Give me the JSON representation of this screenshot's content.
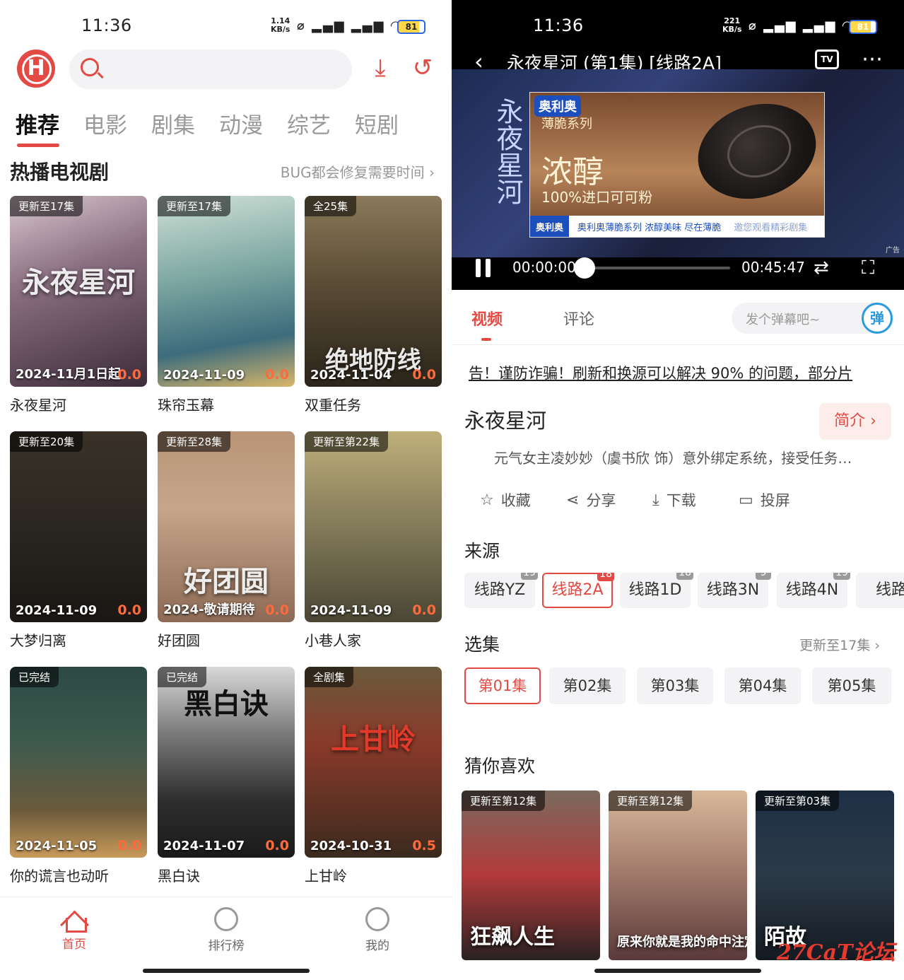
{
  "left": {
    "status": {
      "time": "11:36",
      "speed_top": "1.14",
      "speed_unit": "KB/s",
      "battery": "81"
    },
    "logo": "H",
    "tabs": [
      "推荐",
      "电影",
      "剧集",
      "动漫",
      "综艺",
      "短剧"
    ],
    "section_title": "热播电视剧",
    "section_more": "BUG都会修复需要时间",
    "cards": [
      {
        "badge": "更新至17集",
        "date": "2024-11月1日起",
        "score": "0.0",
        "title": "永夜星河",
        "overlay": "永夜星河"
      },
      {
        "badge": "更新至17集",
        "date": "2024-11-09",
        "score": "0.0",
        "title": "珠帘玉幕",
        "overlay": ""
      },
      {
        "badge": "全25集",
        "date": "2024-11-04",
        "score": "0.0",
        "title": "双重任务",
        "overlay": "绝地防线"
      },
      {
        "badge": "更新至20集",
        "date": "2024-11-09",
        "score": "0.0",
        "title": "大梦归离",
        "overlay": ""
      },
      {
        "badge": "更新至28集",
        "date": "2024-敬请期待",
        "score": "0.0",
        "title": "好团圆",
        "overlay": "好团圆"
      },
      {
        "badge": "更新至第22集",
        "date": "2024-11-09",
        "score": "0.0",
        "title": "小巷人家",
        "overlay": ""
      },
      {
        "badge": "已完结",
        "date": "2024-11-05",
        "score": "0.0",
        "title": "你的谎言也动听",
        "overlay": ""
      },
      {
        "badge": "已完结",
        "date": "2024-11-07",
        "score": "0.0",
        "title": "黑白诀",
        "overlay": "黑白诀"
      },
      {
        "badge": "全剧集",
        "date": "2024-10-31",
        "score": "0.5",
        "title": "上甘岭",
        "overlay": "上甘岭"
      }
    ],
    "bottom_nav": [
      "首页",
      "排行榜",
      "我的"
    ]
  },
  "right": {
    "status": {
      "time": "11:36",
      "speed_top": "221",
      "speed_unit": "KB/s",
      "battery": "81"
    },
    "player": {
      "title": "永夜星河 (第1集) [线路2A]",
      "tv_label": "TV",
      "current_time": "00:00:00",
      "duration": "00:45:47",
      "progress": 0.0,
      "video_text": "永夜星河",
      "ad": {
        "brand": "奥利奥",
        "subline": "薄脆系列",
        "headline": "浓醇",
        "tagline": "100%进口可可粉",
        "bar_brand": "奥利奥",
        "bar_text": "奥利奥薄脆系列 浓醇美味 尽在薄脆",
        "bar_tail": "邀您观看精彩剧集",
        "ad_tag": "广告"
      }
    },
    "tabs": [
      "视频",
      "评论"
    ],
    "danmu_placeholder": "发个弹幕吧~",
    "danmu_button": "弹",
    "notice": "告！谨防诈骗！刷新和换源可以解决 90% 的问题，部分片",
    "drama_title": "永夜星河",
    "intro_label": "简介 ›",
    "description": "元气女主凌妙妙（虞书欣 饰）意外绑定系统，接受任务…",
    "actions": [
      {
        "icon": "☆",
        "label": "收藏"
      },
      {
        "icon": "⋖",
        "label": "分享"
      },
      {
        "icon": "⤓",
        "label": "下载"
      },
      {
        "icon": "▭",
        "label": "投屏"
      }
    ],
    "sources_label": "来源",
    "sources": [
      {
        "name": "线路YZ",
        "count": "19"
      },
      {
        "name": "线路2A",
        "count": "18"
      },
      {
        "name": "线路1D",
        "count": "18"
      },
      {
        "name": "线路3N",
        "count": "9"
      },
      {
        "name": "线路4N",
        "count": "19"
      },
      {
        "name": "线路",
        "count": ""
      }
    ],
    "episodes_label": "选集",
    "episodes_more": "更新至17集 ›",
    "episodes": [
      "第01集",
      "第02集",
      "第03集",
      "第04集",
      "第05集"
    ],
    "recommend_label": "猜你喜欢",
    "recommend": [
      {
        "badge": "更新至第12集",
        "title": "狂飙人生"
      },
      {
        "badge": "更新至第12集",
        "title": "原来你就是我的命中注定"
      },
      {
        "badge": "更新至第03集",
        "title": "陌故"
      }
    ],
    "watermark": "27CaT论坛"
  }
}
